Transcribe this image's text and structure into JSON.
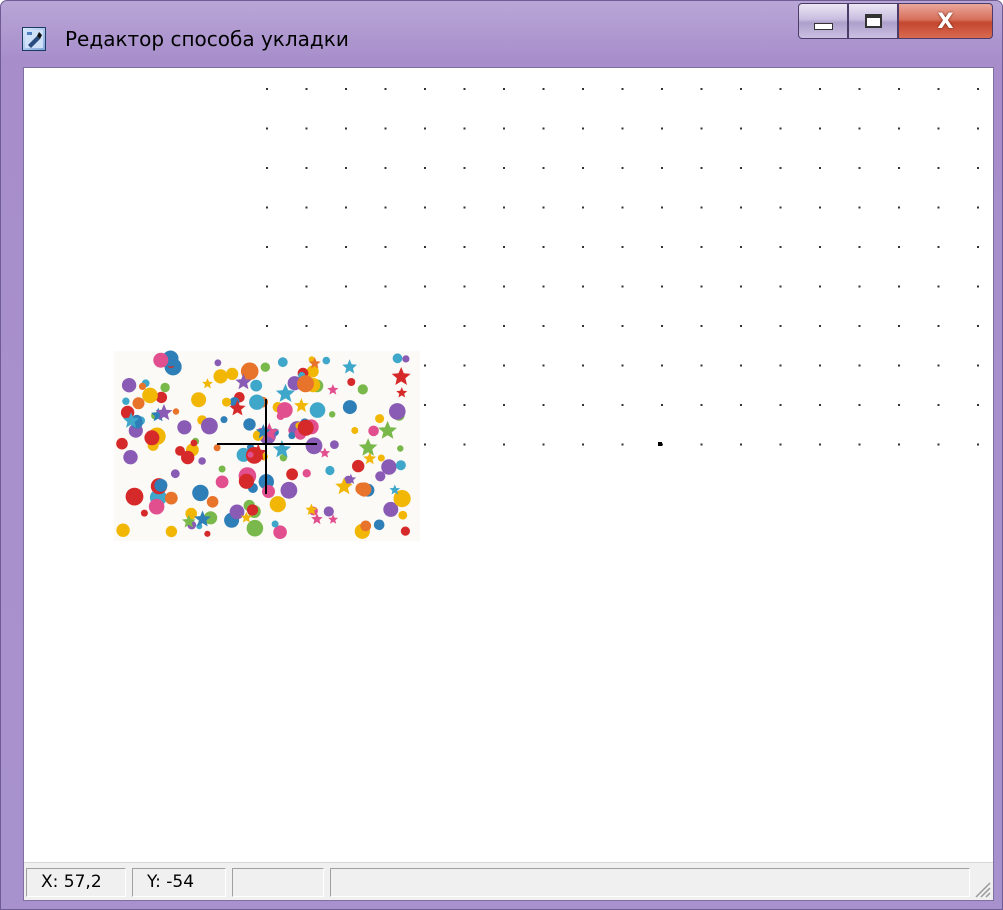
{
  "window": {
    "title": "Редактор способа укладки",
    "icon": "app-editor-icon",
    "buttons": {
      "minimize_icon": "minimize-icon",
      "maximize_icon": "maximize-icon",
      "close_label": "X"
    }
  },
  "canvas": {
    "grid": "dotted",
    "tile_image": "colorful-pattern-tile",
    "cursor": "crosshair"
  },
  "statusbar": {
    "x_value": "X: 57,2",
    "y_value": "Y: -54",
    "panel3": "",
    "panel4": ""
  },
  "colors": {
    "title_gradient": "#a78ecb",
    "close_button": "#c4472f"
  }
}
